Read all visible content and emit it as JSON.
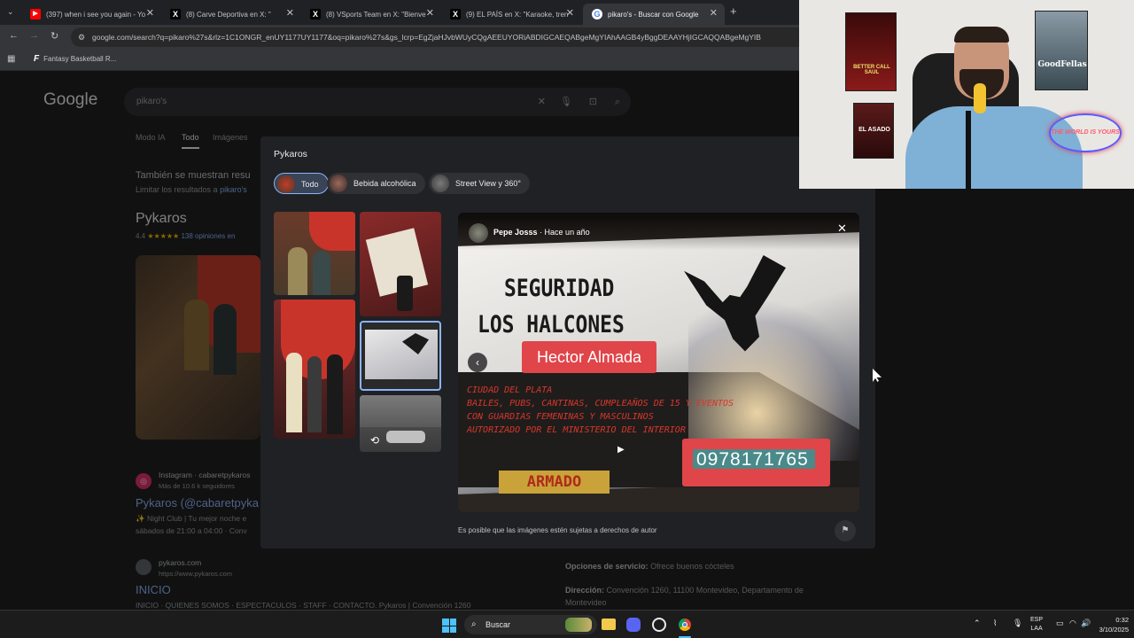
{
  "tabs": [
    {
      "title": "(397) when i see you again - Yo",
      "icon": "youtube-icon",
      "color": "#ff0000"
    },
    {
      "title": "(8) Carve Deportiva en X: \"",
      "icon": "x-icon",
      "color": "#000000"
    },
    {
      "title": "(8) VSports Team en X: \"Bienve",
      "icon": "x-icon",
      "color": "#000000"
    },
    {
      "title": "(9) EL PAÍS en X: \"Karaoke, tren",
      "icon": "x-icon",
      "color": "#000000"
    },
    {
      "title": "pikaro's - Buscar con Google",
      "icon": "google-icon",
      "color": "#4285f4"
    }
  ],
  "url": "google.com/search?q=pikaro%27s&rlz=1C1ONGR_enUY1177UY1177&oq=pikaro%27s&gs_lcrp=EgZjaHJvbWUyCQgAEEUYORiABDIGCAEQABgeMgYIAhAAGB4yBggDEAAYHjIGCAQQABgeMgYIB",
  "bookmark": "Fantasy Basketball R...",
  "google": {
    "logo": "Google",
    "query": "pikaro's",
    "tabs": [
      "Modo IA",
      "Todo",
      "Imágenes"
    ],
    "also_showing": "También se muestran resu",
    "limit_results": "Limitar los resultados a",
    "limit_link": "pikaro's",
    "place_title": "Pykaros",
    "rating": "4.4",
    "reviews": "138 opiniones en",
    "instagram_source": "Instagram · cabaretpykaros",
    "instagram_followers": "Más de 10.6 k seguidores",
    "instagram_title": "Pykaros (@cabaretpyka",
    "instagram_snippet1": "✨ Night Club | Tu mejor noche e",
    "instagram_snippet2": "sábados de 21:00 a 04:00 · Conv",
    "site_name": "pykaros.com",
    "site_url": "https://www.pykaros.com",
    "site_title": "INICIO",
    "site_snippet": "INICIO · QUIENES SOMOS · ESPECTACULOS · STAFF · CONTACTO. Pykaros | Convención 1260",
    "service_label": "Opciones de servicio:",
    "service_value": "Ofrece buenos cócteles",
    "address_label": "Dirección:",
    "address_value": "Convención 1260, 11100 Montevideo, Departamento de",
    "address_value2": "Montevideo"
  },
  "panel": {
    "title": "Pykaros",
    "chips": [
      "Todo",
      "Bebida alcohólica",
      "Street View y 360°"
    ],
    "author": "Pepe Josss",
    "time": "Hace un año",
    "copyright": "Es posible que las imágenes estén sujetas a derechos de autor",
    "image_text": {
      "line1": "SEGURIDAD",
      "line2": "LOS HALCONES",
      "name": "Hector Almada",
      "desc1": "CIUDAD DEL PLATA",
      "desc2": "BAILES, PUBS, CANTINAS, CUMPLEAÑOS DE 15 Y EVENTOS",
      "desc3": "CON GUARDIAS FEMENINAS Y MASCULINOS",
      "desc4": "AUTORIZADO POR EL MINISTERIO DEL INTERIOR",
      "phone": "0978171765",
      "armado": "ARMADO"
    }
  },
  "taskbar": {
    "search": "Buscar",
    "lang1": "ESP",
    "lang2": "LAA",
    "time": "0:32",
    "date": "3/10/2025"
  },
  "webcam": {
    "poster1": "BETTER CALL SAUL",
    "poster2": "GoodFellas",
    "poster3": "EL ASADO",
    "sign": "THE WORLD IS YOURS"
  }
}
